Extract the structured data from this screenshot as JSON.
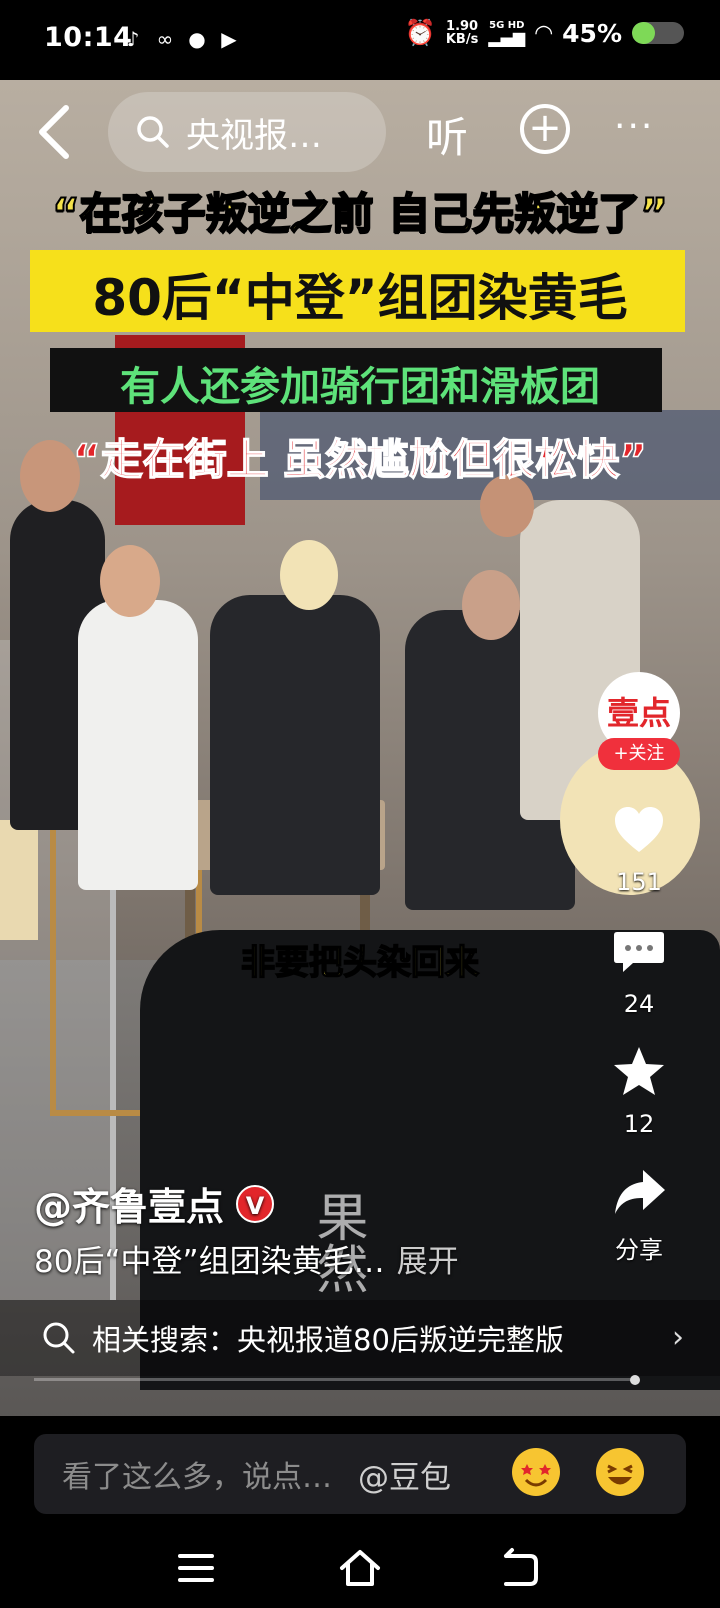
{
  "status_bar": {
    "time": "10:14",
    "net_speed_value": "1.90",
    "net_speed_unit": "KB/s",
    "signal_tag": "5G HD",
    "battery_percent": "45%",
    "battery_level": 0.45
  },
  "top_nav": {
    "search_text": "央视报…",
    "listen_label": "听"
  },
  "captions": {
    "line1": "“在孩子叛逆之前 自己先叛逆了”",
    "line2": "80后“中登”组团染黄毛",
    "line3": "有人还参加骑行团和滑板团",
    "line4": "“走在街上 虽然尴尬但很松快”",
    "subtitle": "非要把头染回来",
    "watermark": "果然"
  },
  "side_rail": {
    "avatar_text": "壹点",
    "follow_label": "+关注",
    "likes": "151",
    "comments": "24",
    "favorites": "12",
    "share_label": "分享"
  },
  "author": {
    "name": "@齐鲁壹点",
    "verified_badge": "V",
    "description": "80后“中登”组团染黄毛…",
    "expand_label": "展开"
  },
  "related": {
    "text": "相关搜索：央视报道80后叛逆完整版"
  },
  "comment_bar": {
    "placeholder": "看了这么多，说点…",
    "mention": "@豆包"
  },
  "colors": {
    "caption_yellow": "#f3e14a",
    "caption_green": "#5ee27a",
    "caption_red": "#e2262b",
    "follow_red": "#f0303c",
    "battery_green": "#7ed957"
  }
}
